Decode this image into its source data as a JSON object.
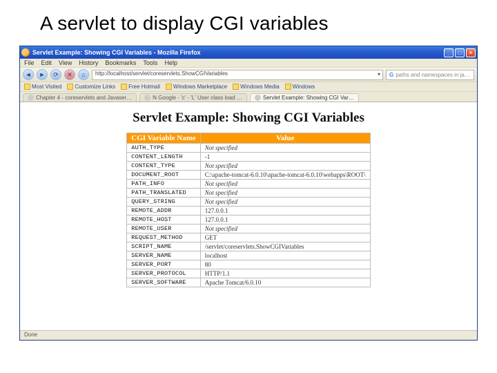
{
  "slide": {
    "title": "A servlet to display CGI variables"
  },
  "window": {
    "title": "Servlet Example: Showing CGI Variables - Mozilla Firefox",
    "minimize": "_",
    "maximize": "□",
    "close": "×"
  },
  "menu": {
    "file": "File",
    "edit": "Edit",
    "view": "View",
    "history": "History",
    "bookmarks": "Bookmarks",
    "tools": "Tools",
    "help": "Help"
  },
  "toolbar": {
    "url": "http://localhost/servlet/coreservlets.ShowCGIVariables",
    "search_placeholder": "paths and namespaces in ja…"
  },
  "bookmarks": {
    "most_visited": "Most Visited",
    "customize": "Customize Links",
    "hotmail": "Free Hotmail",
    "marketplace": "Windows Marketplace",
    "media": "Windows Media",
    "windows": "Windows"
  },
  "tabs": {
    "t1": "Chapter 4 - coreservlets and Javaser…",
    "t2": "N Google - 'c' - 'L' User class load …",
    "t3": "Servlet Example: Showing CGI Var…"
  },
  "page": {
    "heading": "Servlet Example: Showing CGI Variables",
    "col_name": "CGI Variable Name",
    "col_value": "Value",
    "rows": [
      {
        "name": "AUTH_TYPE",
        "value": "Not specified",
        "italic": true
      },
      {
        "name": "CONTENT_LENGTH",
        "value": "-1"
      },
      {
        "name": "CONTENT_TYPE",
        "value": "Not specified",
        "italic": true
      },
      {
        "name": "DOCUMENT_ROOT",
        "value": "C:\\apache-tomcat-6.0.10\\apache-tomcat-6.0.10\\webapps\\ROOT\\"
      },
      {
        "name": "PATH_INFO",
        "value": "Not specified",
        "italic": true
      },
      {
        "name": "PATH_TRANSLATED",
        "value": "Not specified",
        "italic": true
      },
      {
        "name": "QUERY_STRING",
        "value": "Not specified",
        "italic": true
      },
      {
        "name": "REMOTE_ADDR",
        "value": "127.0.0.1"
      },
      {
        "name": "REMOTE_HOST",
        "value": "127.0.0.1"
      },
      {
        "name": "REMOTE_USER",
        "value": "Not specified",
        "italic": true
      },
      {
        "name": "REQUEST_METHOD",
        "value": "GET"
      },
      {
        "name": "SCRIPT_NAME",
        "value": "/servlet/coreservlets.ShowCGIVariables"
      },
      {
        "name": "SERVER_NAME",
        "value": "localhost"
      },
      {
        "name": "SERVER_PORT",
        "value": "80"
      },
      {
        "name": "SERVER_PROTOCOL",
        "value": "HTTP/1.1"
      },
      {
        "name": "SERVER_SOFTWARE",
        "value": "Apache Tomcat/6.0.10"
      }
    ]
  },
  "status": {
    "text": "Done"
  }
}
